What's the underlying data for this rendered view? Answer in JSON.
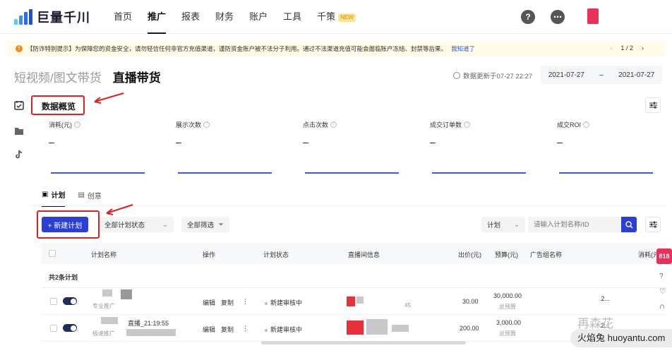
{
  "brand": {
    "name": "巨量千川"
  },
  "nav": {
    "items": [
      "首页",
      "推广",
      "报表",
      "财务",
      "账户",
      "工具",
      "千策"
    ],
    "new_badge": "NEW",
    "active": "推广"
  },
  "notice": {
    "text": "【防诈特别提示】为保障您的资金安全，请勿轻信任何非官方充值渠道，谨防资金账户被不法分子利用。通过不法渠道充值可能会面临账户冻结、封禁等后果。",
    "link": "我知道了",
    "page_current": "1",
    "page_sep": "/",
    "page_total": "2"
  },
  "header": {
    "tab_inactive": "短视频/图文带货",
    "tab_active": "直播带货",
    "update_text": "数据更新于07-27 22:27",
    "date_start": "2021-07-27",
    "date_sep": "–",
    "date_end": "2021-07-27"
  },
  "overview": {
    "title": "数据概览",
    "metrics": [
      {
        "label": "消耗(元)",
        "value": "–"
      },
      {
        "label": "展示次数",
        "value": "–"
      },
      {
        "label": "点击次数",
        "value": "–"
      },
      {
        "label": "成交订单数",
        "value": "–"
      },
      {
        "label": "成交ROI",
        "value": "–"
      }
    ]
  },
  "subtabs": [
    "计划",
    "创意"
  ],
  "toolbar": {
    "new_plan": "+ 新建计划",
    "status_select": "全部计划状态",
    "filter_all": "全部筛选",
    "search_type": "计划",
    "search_placeholder": "请输入计划名称/ID"
  },
  "table": {
    "headers": [
      "计划名称",
      "操作",
      "计划状态",
      "直播间信息",
      "出价(元)",
      "预算(元)",
      "广告组名称",
      "消耗(元"
    ],
    "summary": "共2条计划",
    "rows": [
      {
        "name_suffix": "",
        "tag": "专业推广",
        "actions": [
          "编辑",
          "复制",
          "⋮"
        ],
        "status": "新建审核中",
        "live_suffix": "45",
        "bid": "30.00",
        "budget": "30,000.00",
        "budget_label": "总预算",
        "group_suffix": ".2..."
      },
      {
        "name_suffix": "直播_21:19:55",
        "tag": "极速推广",
        "actions": [
          "编辑",
          "复制",
          "⋮"
        ],
        "status": "新建审核中",
        "live_suffix": "",
        "bid": "200.00",
        "budget": "3,000.00",
        "budget_label": "总预算",
        "group_suffix": "2..."
      }
    ]
  },
  "watermark": {
    "top": "再森花",
    "bottom": "火焰兔 huoyantu.com"
  },
  "side_badge": "818",
  "colors": {
    "primary": "#2b3fd6",
    "callout": "#e02020",
    "notice_bg": "#fffbe6"
  }
}
